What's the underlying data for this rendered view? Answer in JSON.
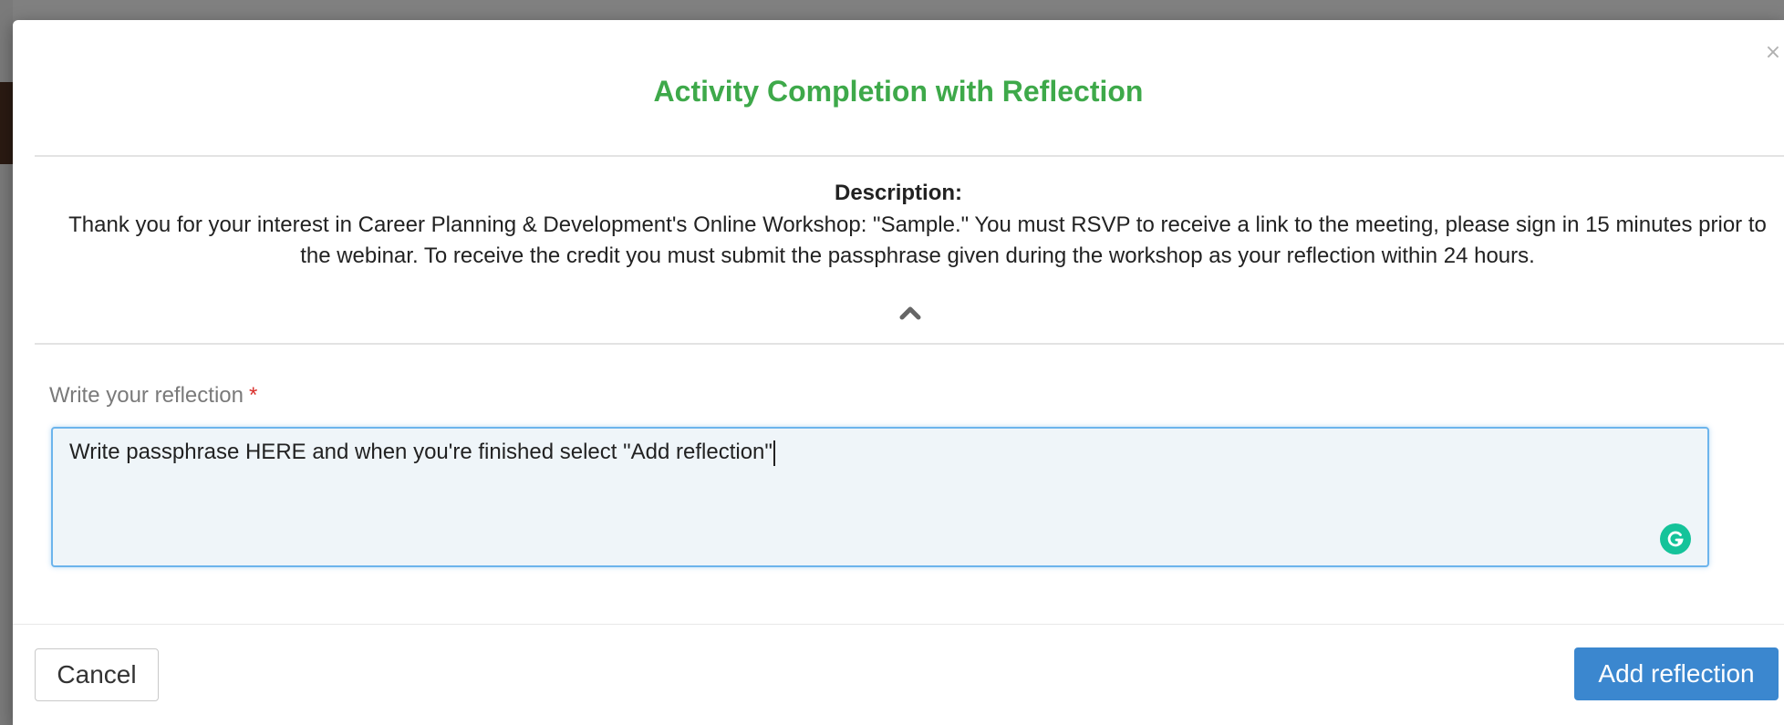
{
  "modal": {
    "title": "Activity Completion with Reflection",
    "close_label": "×",
    "description_label": "Description:",
    "description_text": "Thank you for your interest in Career Planning & Development's Online Workshop: \"Sample.\" You must RSVP to receive a link to the meeting, please sign in 15 minutes prior to the webinar. To receive the credit you must submit the passphrase given during the workshop as your reflection within 24 hours.",
    "collapse_icon": "chevron-up-icon"
  },
  "reflection": {
    "label": "Write your reflection",
    "required_marker": "*",
    "value": "Write passphrase HERE and when you're finished select \"Add reflection\"",
    "assistant_icon": "grammarly-icon"
  },
  "footer": {
    "cancel_label": "Cancel",
    "submit_label": "Add reflection"
  },
  "colors": {
    "title": "#3ea94a",
    "primary_button": "#3b87cf",
    "required": "#d9302c",
    "textarea_focus": "#6cb4ec",
    "grammarly": "#15c39a"
  }
}
